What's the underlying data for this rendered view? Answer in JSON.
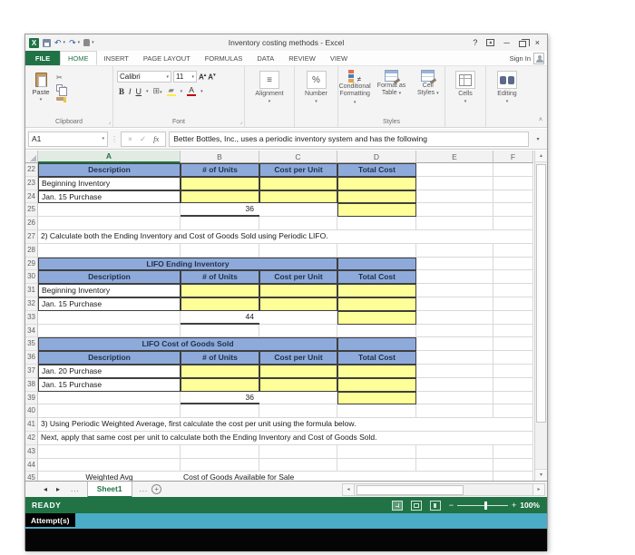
{
  "window": {
    "title": "Inventory costing methods - Excel"
  },
  "icons": {
    "undo": "↶",
    "redo": "↷",
    "dropdown": "▾",
    "help": "?",
    "minimize": "─",
    "close": "×",
    "cut": "✂",
    "borders": "⊞",
    "align": "≡",
    "launcher": "⌟",
    "collapse": "˄",
    "dots": "⋮",
    "cancel": "×",
    "check": "✓",
    "fx": "fx",
    "prev": "◂",
    "next": "▸",
    "up": "▴",
    "down": "▾",
    "left": "◂",
    "right": "▸",
    "plus": "+",
    "minus": "−",
    "a_upper": "A",
    "logo": "X"
  },
  "tabs": {
    "file": "FILE",
    "items": [
      "HOME",
      "INSERT",
      "PAGE LAYOUT",
      "FORMULAS",
      "DATA",
      "REVIEW",
      "VIEW"
    ],
    "active": "HOME",
    "sign_in": "Sign In"
  },
  "ribbon": {
    "clipboard": {
      "group_label": "Clipboard",
      "paste_label": "Paste"
    },
    "font": {
      "group_label": "Font",
      "font_name": "Calibri",
      "font_size": "11",
      "bold": "B",
      "italic": "I",
      "underline": "U"
    },
    "alignment": {
      "group_label": "Alignment"
    },
    "number": {
      "group_label": "Number",
      "percent": "%"
    },
    "styles": {
      "group_label": "Styles",
      "conditional_1": "Conditional",
      "conditional_2": "Formatting",
      "format_table_1": "Format as",
      "format_table_2": "Table",
      "cell_styles_1": "Cell",
      "cell_styles_2": "Styles"
    },
    "cells": {
      "group_label": "Cells"
    },
    "editing": {
      "group_label": "Editing"
    }
  },
  "formula_bar": {
    "name_box": "A1",
    "value": "Better Bottles, Inc., uses a periodic inventory system and has the following"
  },
  "grid": {
    "columns": [
      "A",
      "B",
      "C",
      "D",
      "E",
      "F"
    ],
    "active_column": "A",
    "rows": [
      {
        "n": 22,
        "cells": [
          {
            "col": "A",
            "type": "th",
            "text": "Description"
          },
          {
            "col": "B",
            "type": "th",
            "text": "# of Units"
          },
          {
            "col": "C",
            "type": "th",
            "text": "Cost per Unit"
          },
          {
            "col": "D",
            "type": "th",
            "text": "Total Cost"
          }
        ]
      },
      {
        "n": 23,
        "cells": [
          {
            "col": "A",
            "type": "label",
            "text": "Beginning Inventory"
          },
          {
            "col": "B",
            "type": "input"
          },
          {
            "col": "C",
            "type": "input"
          },
          {
            "col": "D",
            "type": "input"
          }
        ]
      },
      {
        "n": 24,
        "cells": [
          {
            "col": "A",
            "type": "label",
            "text": "Jan. 15 Purchase"
          },
          {
            "col": "B",
            "type": "input"
          },
          {
            "col": "C",
            "type": "input"
          },
          {
            "col": "D",
            "type": "input"
          }
        ]
      },
      {
        "n": 25,
        "cells": [
          {
            "col": "B",
            "type": "total",
            "text": "36"
          },
          {
            "col": "D",
            "type": "input"
          }
        ]
      },
      {
        "n": 26,
        "cells": []
      },
      {
        "n": 27,
        "cells": [
          {
            "col": "A",
            "span": 5,
            "type": "text",
            "text": "2) Calculate both the Ending Inventory and Cost of Goods Sold using Periodic LIFO."
          }
        ]
      },
      {
        "n": 28,
        "cells": []
      },
      {
        "n": 29,
        "cells": [
          {
            "col": "A",
            "span": 3,
            "type": "title",
            "text": "LIFO Ending Inventory"
          },
          {
            "col": "D",
            "type": "titlecap"
          }
        ]
      },
      {
        "n": 30,
        "cells": [
          {
            "col": "A",
            "type": "th",
            "text": "Description"
          },
          {
            "col": "B",
            "type": "th",
            "text": "# of Units"
          },
          {
            "col": "C",
            "type": "th",
            "text": "Cost per Unit"
          },
          {
            "col": "D",
            "type": "th",
            "text": "Total Cost"
          }
        ]
      },
      {
        "n": 31,
        "cells": [
          {
            "col": "A",
            "type": "label",
            "text": "Beginning Inventory"
          },
          {
            "col": "B",
            "type": "input"
          },
          {
            "col": "C",
            "type": "input"
          },
          {
            "col": "D",
            "type": "input"
          }
        ]
      },
      {
        "n": 32,
        "cells": [
          {
            "col": "A",
            "type": "label",
            "text": "Jan. 15 Purchase"
          },
          {
            "col": "B",
            "type": "input"
          },
          {
            "col": "C",
            "type": "input"
          },
          {
            "col": "D",
            "type": "input"
          }
        ]
      },
      {
        "n": 33,
        "cells": [
          {
            "col": "B",
            "type": "total",
            "text": "44"
          },
          {
            "col": "D",
            "type": "input"
          }
        ]
      },
      {
        "n": 34,
        "cells": []
      },
      {
        "n": 35,
        "cells": [
          {
            "col": "A",
            "span": 3,
            "type": "title",
            "text": "LIFO Cost of Goods Sold"
          },
          {
            "col": "D",
            "type": "titlecap"
          }
        ]
      },
      {
        "n": 36,
        "cells": [
          {
            "col": "A",
            "type": "th",
            "text": "Description"
          },
          {
            "col": "B",
            "type": "th",
            "text": "# of Units"
          },
          {
            "col": "C",
            "type": "th",
            "text": "Cost per Unit"
          },
          {
            "col": "D",
            "type": "th",
            "text": "Total Cost"
          }
        ]
      },
      {
        "n": 37,
        "cells": [
          {
            "col": "A",
            "type": "label",
            "text": "Jan. 20 Purchase"
          },
          {
            "col": "B",
            "type": "input"
          },
          {
            "col": "C",
            "type": "input"
          },
          {
            "col": "D",
            "type": "input"
          }
        ]
      },
      {
        "n": 38,
        "cells": [
          {
            "col": "A",
            "type": "label",
            "text": "Jan. 15 Purchase"
          },
          {
            "col": "B",
            "type": "input"
          },
          {
            "col": "C",
            "type": "input"
          },
          {
            "col": "D",
            "type": "input"
          }
        ]
      },
      {
        "n": 39,
        "cells": [
          {
            "col": "B",
            "type": "total",
            "text": "36"
          },
          {
            "col": "D",
            "type": "input"
          }
        ]
      },
      {
        "n": 40,
        "cells": []
      },
      {
        "n": 41,
        "cells": [
          {
            "col": "A",
            "span": 5,
            "type": "text",
            "text": "3) Using Periodic Weighted Average, first calculate the cost per unit using the formula below."
          }
        ]
      },
      {
        "n": 42,
        "cells": [
          {
            "col": "A",
            "span": 5,
            "type": "text",
            "text": "Next, apply that same cost per unit to calculate both the Ending Inventory and Cost of Goods Sold."
          }
        ]
      },
      {
        "n": 43,
        "cells": []
      },
      {
        "n": 44,
        "cells": []
      },
      {
        "n": 45,
        "cells": [
          {
            "col": "A",
            "type": "textc",
            "text": "Weighted Avg"
          },
          {
            "col": "B",
            "span": 3,
            "type": "text",
            "text": "Cost of Goods Available for Sale"
          }
        ]
      }
    ]
  },
  "sheet_bar": {
    "active_tab": "Sheet1",
    "ellipsis_left": "...",
    "ellipsis_right": "..."
  },
  "status_bar": {
    "mode": "READY",
    "zoom_level": "100%"
  },
  "attempt_bar": {
    "label": "Attempt(s)"
  },
  "colors": {
    "excel_green": "#217346",
    "header_blue": "#8EAADB",
    "input_yellow": "#FFFF99",
    "attempt_teal": "#4BACC6"
  }
}
